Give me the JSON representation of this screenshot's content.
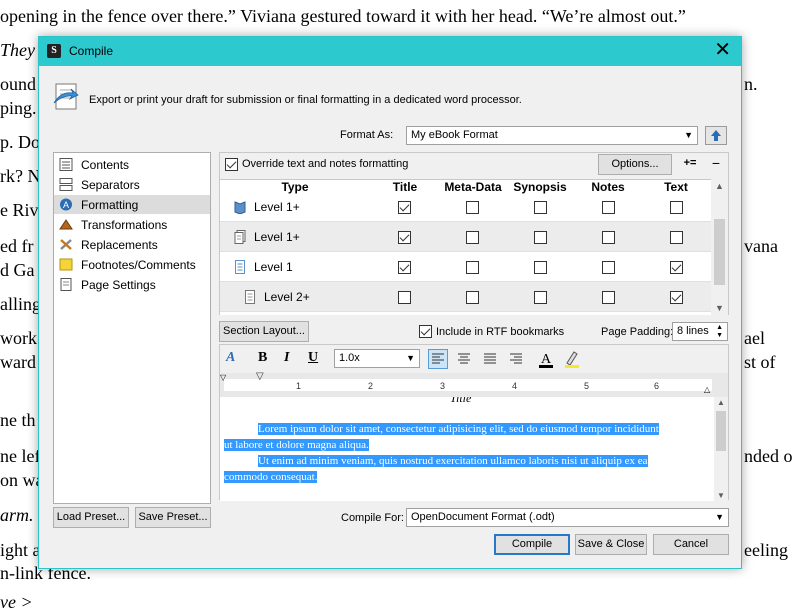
{
  "background_doc": {
    "lines": [
      "opening in the fence over there.” Viviana gestured toward it with her head. “We’re almost out.”",
      "They",
      "ound",
      "ping.",
      "p. Do",
      "rk? N",
      "e Riv",
      "ed fr",
      "d Ga",
      "alling",
      "work",
      "ward",
      "ne th",
      "ne lef",
      "on wa",
      "arm.",
      "ight a",
      "n-link fence.",
      "n.",
      "vana",
      "ael",
      "st of",
      "nded o",
      "eeling",
      "ve >"
    ]
  },
  "window": {
    "title": "Compile"
  },
  "header": {
    "description": "Export or print your draft for submission or final formatting in a dedicated word processor."
  },
  "format_as": {
    "label": "Format As:",
    "value": "My eBook Format"
  },
  "sidebar": {
    "items": [
      {
        "label": "Contents",
        "icon": "contents-icon"
      },
      {
        "label": "Separators",
        "icon": "separators-icon"
      },
      {
        "label": "Formatting",
        "icon": "formatting-icon",
        "selected": true
      },
      {
        "label": "Transformations",
        "icon": "transformations-icon"
      },
      {
        "label": "Replacements",
        "icon": "replacements-icon"
      },
      {
        "label": "Footnotes/Comments",
        "icon": "footnotes-icon"
      },
      {
        "label": "Page Settings",
        "icon": "page-settings-icon"
      }
    ]
  },
  "formatting": {
    "override_label": "Override text and notes formatting",
    "override_checked": true,
    "options_label": "Options...",
    "add_symbol": "+=",
    "remove_symbol": "−",
    "columns": [
      "Type",
      "Title",
      "Meta-Data",
      "Synopsis",
      "Notes",
      "Text"
    ],
    "rows": [
      {
        "type": "Level 1+",
        "icon": "folder-icon",
        "checks": [
          true,
          false,
          false,
          false,
          false
        ]
      },
      {
        "type": "Level 1+",
        "icon": "document-stack-icon",
        "checks": [
          true,
          false,
          false,
          false,
          false
        ]
      },
      {
        "type": "Level 1",
        "icon": "document-icon",
        "checks": [
          true,
          false,
          false,
          false,
          true
        ]
      },
      {
        "type": "Level 2+",
        "icon": "document-small-icon",
        "checks": [
          false,
          false,
          false,
          false,
          true
        ]
      }
    ]
  },
  "section": {
    "layout_label": "Section Layout...",
    "rtf_label": "Include in RTF bookmarks",
    "rtf_checked": true,
    "padding_label": "Page Padding:",
    "padding_value": "8 lines"
  },
  "editor": {
    "bold": "B",
    "italic": "I",
    "underline": "U",
    "line_spacing": "1.0x",
    "ruler_numbers": [
      "1",
      "2",
      "3",
      "4",
      "5",
      "6"
    ],
    "title_text": "Title",
    "paragraph1": "Lorem ipsum dolor sit amet, consectetur adipisicing elit, sed do eiusmod tempor incididunt",
    "paragraph1b": "ut labore et dolore magna aliqua.",
    "paragraph2": "Ut enim ad minim veniam, quis nostrud exercitation ullamco laboris nisi ut aliquip ex ea",
    "paragraph2b": "commodo consequat."
  },
  "footer": {
    "load_preset": "Load Preset...",
    "save_preset": "Save Preset...",
    "compile_for_label": "Compile For:",
    "compile_for_value": "OpenDocument Format (.odt)",
    "compile_btn": "Compile",
    "save_close_btn": "Save & Close",
    "cancel_btn": "Cancel"
  },
  "colors": {
    "titlebar": "#2ccacf",
    "selection": "#3399ff",
    "primary_border": "#2977c8"
  }
}
